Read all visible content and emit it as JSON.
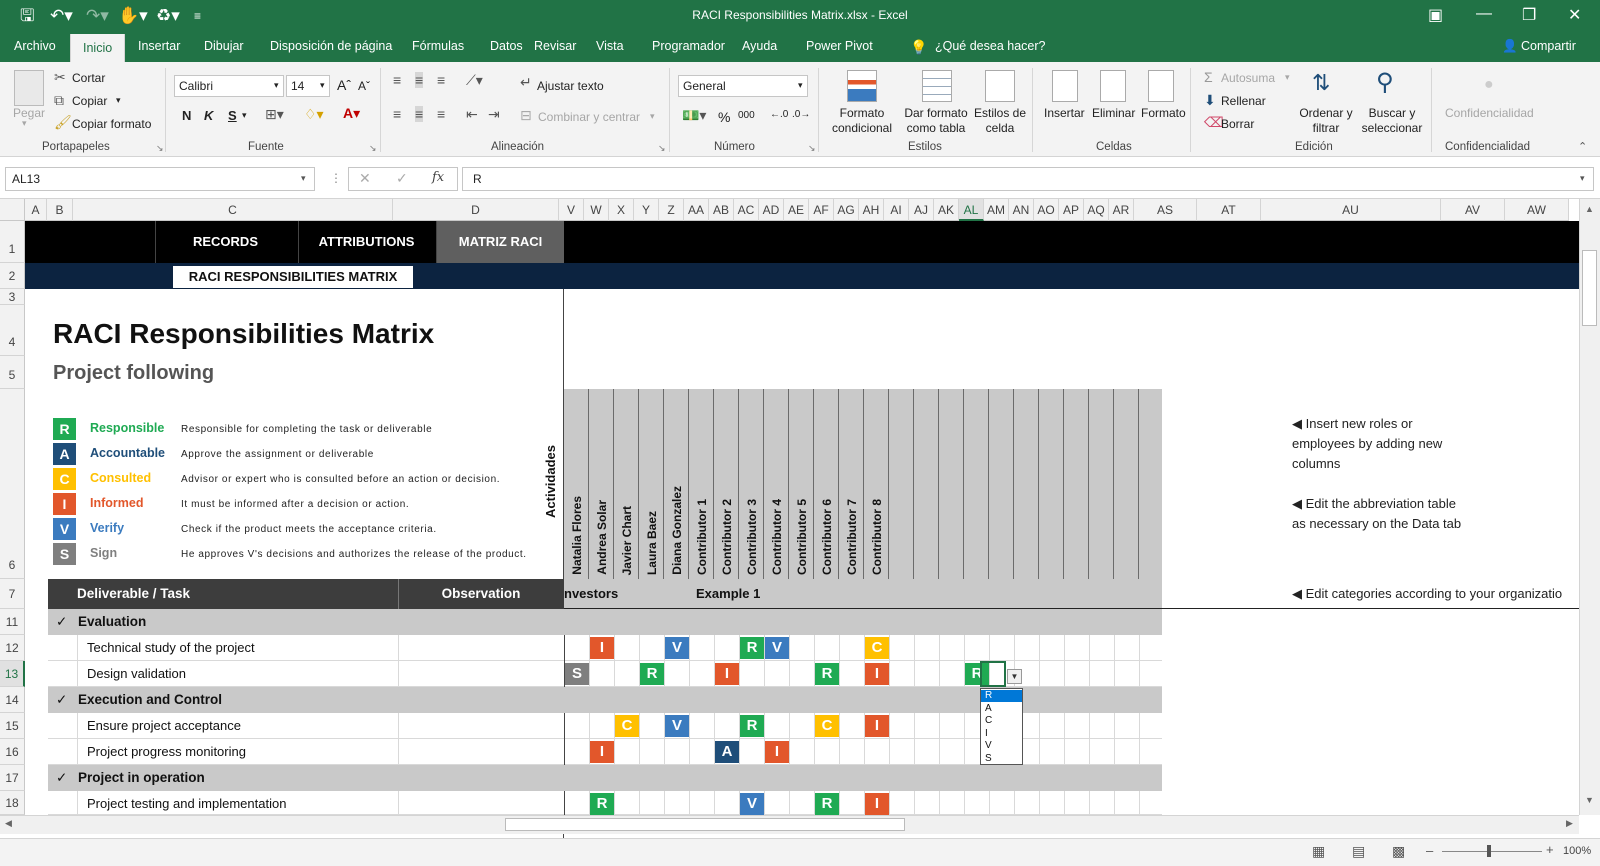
{
  "window": {
    "title": "RACI Responsibilities Matrix.xlsx  -  Excel",
    "share": "Compartir",
    "tell_me": "¿Qué desea hacer?"
  },
  "colors": {
    "green": "#217346",
    "R": "#1faa53",
    "A": "#1f4e79",
    "C": "#ffc000",
    "I": "#e2572b",
    "V": "#3b7bbf",
    "S": "#7f7f7f"
  },
  "ribbon_tabs": [
    "Archivo",
    "Inicio",
    "Insertar",
    "Dibujar",
    "Disposición de página",
    "Fórmulas",
    "Datos",
    "Revisar",
    "Vista",
    "Programador",
    "Ayuda",
    "Power Pivot"
  ],
  "ribbon": {
    "clipboard": {
      "paste": "Pegar",
      "cut": "Cortar",
      "copy": "Copiar",
      "format_painter": "Copiar formato",
      "group": "Portapapeles"
    },
    "font": {
      "name": "Calibri",
      "size": "14",
      "bold": "N",
      "italic": "K",
      "underline": "S",
      "group": "Fuente"
    },
    "alignment": {
      "wrap": "Ajustar texto",
      "merge": "Combinar y centrar",
      "group": "Alineación"
    },
    "number": {
      "format": "General",
      "group": "Número"
    },
    "styles": {
      "cond_format": "Formato condicional",
      "as_table": "Dar formato como tabla",
      "cell_styles": "Estilos de celda",
      "group": "Estilos"
    },
    "cells": {
      "insert": "Insertar",
      "delete": "Eliminar",
      "format": "Formato",
      "group": "Celdas"
    },
    "editing": {
      "autosum": "Autosuma",
      "fill": "Rellenar",
      "clear": "Borrar",
      "sort": "Ordenar y filtrar",
      "find": "Buscar y seleccionar",
      "group": "Edición"
    },
    "sensitivity": {
      "label": "Confidencialidad",
      "group": "Confidencialidad"
    }
  },
  "formula_bar": {
    "name_box": "AL13",
    "fx": "fx",
    "value": "R"
  },
  "columns": [
    "A",
    "B",
    "C",
    "D",
    "V",
    "W",
    "X",
    "Y",
    "Z",
    "AA",
    "AB",
    "AC",
    "AD",
    "AE",
    "AF",
    "AG",
    "AH",
    "AI",
    "AJ",
    "AK",
    "AL",
    "AM",
    "AN",
    "AO",
    "AP",
    "AQ",
    "AR",
    "AS",
    "AT",
    "AU",
    "AV",
    "AW"
  ],
  "rows": [
    "1",
    "2",
    "3",
    "4",
    "5",
    "6",
    "7",
    "11",
    "12",
    "13",
    "14",
    "15",
    "16",
    "17",
    "18"
  ],
  "sheet": {
    "nav_tabs": [
      "RECORDS",
      "ATTRIBUTIONS",
      "MATRIZ RACI"
    ],
    "subtitle_banner": "RACI RESPONSIBILITIES MATRIX",
    "title": "RACI Responsibilities Matrix",
    "subtitle": "Project following",
    "legend": [
      {
        "letter": "R",
        "name": "Responsible",
        "desc": "Responsible for completing the task or deliverable"
      },
      {
        "letter": "A",
        "name": "Accountable",
        "desc": "Approve the assignment or deliverable"
      },
      {
        "letter": "C",
        "name": "Consulted",
        "desc": "Advisor or expert who is consulted before an action or decision."
      },
      {
        "letter": "I",
        "name": "Informed",
        "desc": "It must be informed after a decision or action."
      },
      {
        "letter": "V",
        "name": "Verify",
        "desc": "Check if the product meets the acceptance criteria."
      },
      {
        "letter": "S",
        "name": "Sign",
        "desc": "He approves V's decisions and authorizes the release of the product."
      }
    ],
    "activities_label": "Actividades",
    "people": [
      "Natalia Flores",
      "Andrea Solar",
      "Javier Chart",
      "Laura Baez",
      "Diana Gonzalez",
      "Contributor 1",
      "Contributor 2",
      "Contributor 3",
      "Contributor 4",
      "Contributor 5",
      "Contributor 6",
      "Contributor 7",
      "Contributor 8",
      "",
      "",
      "",
      "",
      "",
      "",
      "",
      "",
      "",
      "",
      ""
    ],
    "header_task": "Deliverable / Task",
    "header_obs": "Observation",
    "group_investors": "nvestors",
    "group_example": "Example 1",
    "rows": [
      {
        "type": "cat",
        "label": "Evaluation",
        "check": "✓"
      },
      {
        "type": "task",
        "label": "Technical study of the project",
        "cells": {
          "1": "I",
          "4": "V",
          "7": "R",
          "8": "V",
          "12": "C"
        }
      },
      {
        "type": "task",
        "label": "Design validation",
        "cells": {
          "0": "S",
          "3": "R",
          "6": "I",
          "10": "R",
          "12": "I",
          "16": "R"
        }
      },
      {
        "type": "cat",
        "label": "Execution and Control",
        "check": "✓"
      },
      {
        "type": "task",
        "label": "Ensure project acceptance",
        "cells": {
          "2": "C",
          "4": "V",
          "7": "R",
          "10": "C",
          "12": "I"
        }
      },
      {
        "type": "task",
        "label": "Project progress monitoring",
        "cells": {
          "1": "I",
          "6": "A",
          "8": "I"
        }
      },
      {
        "type": "cat",
        "label": "Project in operation",
        "check": "✓"
      },
      {
        "type": "task",
        "label": "Project testing and implementation",
        "cells": {
          "1": "R",
          "7": "V",
          "10": "R",
          "12": "I"
        }
      }
    ],
    "notes": [
      "◀ Insert new roles or employees by adding new columns",
      "◀ Edit the abbreviation table as necessary on the Data tab",
      "◀ Edit categories according to your organizatio"
    ],
    "dropdown_options": [
      "R",
      "A",
      "C",
      "I",
      "V",
      "S"
    ]
  },
  "status": {
    "zoom": "100%"
  }
}
